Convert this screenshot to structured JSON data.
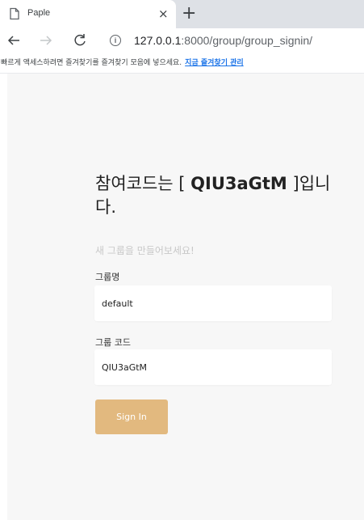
{
  "browser": {
    "tab_title": "Paple",
    "tab_close": "×",
    "new_tab": "+",
    "url_host": "127.0.0.1",
    "url_rest": ":8000/group/group_signin/",
    "bookmarks_message": "빠르게 액세스하려면 즐겨찾기를 즐겨찾기 모음에 넣으세요.",
    "bookmarks_link": "지금 즐겨찾기 관리"
  },
  "page": {
    "heading_prefix": "참여코드는 [ ",
    "heading_code": "QIU3aGtM",
    "heading_suffix": " ]입니다.",
    "subtitle": "새 그룹을 만들어보세요!",
    "group_name_label": "그룹명",
    "group_name_value": "default",
    "group_code_label": "그룹 코드",
    "group_code_value": "QIU3aGtM",
    "signin_label": "Sign In"
  },
  "colors": {
    "signin_button": "#e2b97f",
    "page_background": "#f7f7f7"
  }
}
